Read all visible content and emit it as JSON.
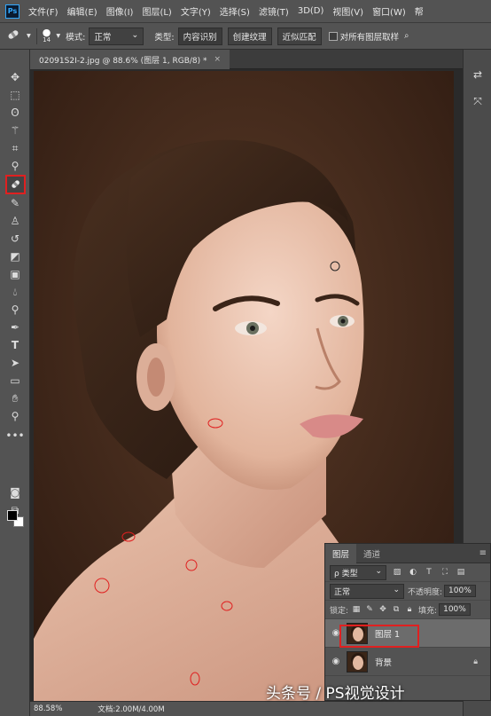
{
  "menubar": {
    "app_icon": "Ps",
    "items": [
      "文件(F)",
      "编辑(E)",
      "图像(I)",
      "图层(L)",
      "文字(Y)",
      "选择(S)",
      "滤镜(T)",
      "3D(D)",
      "视图(V)",
      "窗口(W)",
      "帮"
    ]
  },
  "options": {
    "brush_size": "14",
    "mode_label": "模式:",
    "mode_value": "正常",
    "type_label": "类型:",
    "type_options": [
      "内容识别",
      "创建纹理",
      "近似匹配"
    ],
    "sample_all_label": "对所有图层取样"
  },
  "document": {
    "tab_title": "02091S2I-2.jpg @ 88.6% (图层 1, RGB/8) *",
    "close_glyph": "×"
  },
  "layers_panel": {
    "tabs": [
      "图层",
      "通道"
    ],
    "filter_kind": "ρ 类型",
    "blend_mode": "正常",
    "opacity_label": "不透明度:",
    "opacity_value": "100%",
    "lock_label": "锁定:",
    "fill_label": "填充:",
    "fill_value": "100%",
    "layers": [
      {
        "name": "图层 1",
        "visible": true,
        "selected": true
      },
      {
        "name": "背景",
        "visible": true,
        "selected": false,
        "locked": true
      }
    ]
  },
  "status": {
    "zoom": "88.58%",
    "doc_size": "文档:2.00M/4.00M"
  },
  "watermark": "头条号 / PS视觉设计",
  "colors": {
    "accent_highlight": "#e02020",
    "foreground": "#000000",
    "background": "#ffffff"
  }
}
